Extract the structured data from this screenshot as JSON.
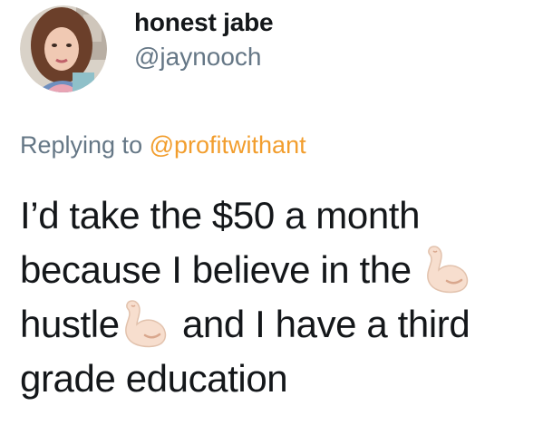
{
  "tweet": {
    "display_name": "honest jabe",
    "handle": "@jaynooch",
    "replying_prefix": "Replying to",
    "replying_to": "@profitwithant",
    "text_segments": [
      "I’d take the $50 a month because I believe in the",
      "hustle",
      "and I have a third grade education"
    ],
    "emoji": "flexed-biceps"
  },
  "colors": {
    "name": "#14171a",
    "secondary": "#657786",
    "mention": "#f29e2e",
    "emoji_skin": "#f7dece",
    "emoji_outline": "#e2c2ad"
  }
}
